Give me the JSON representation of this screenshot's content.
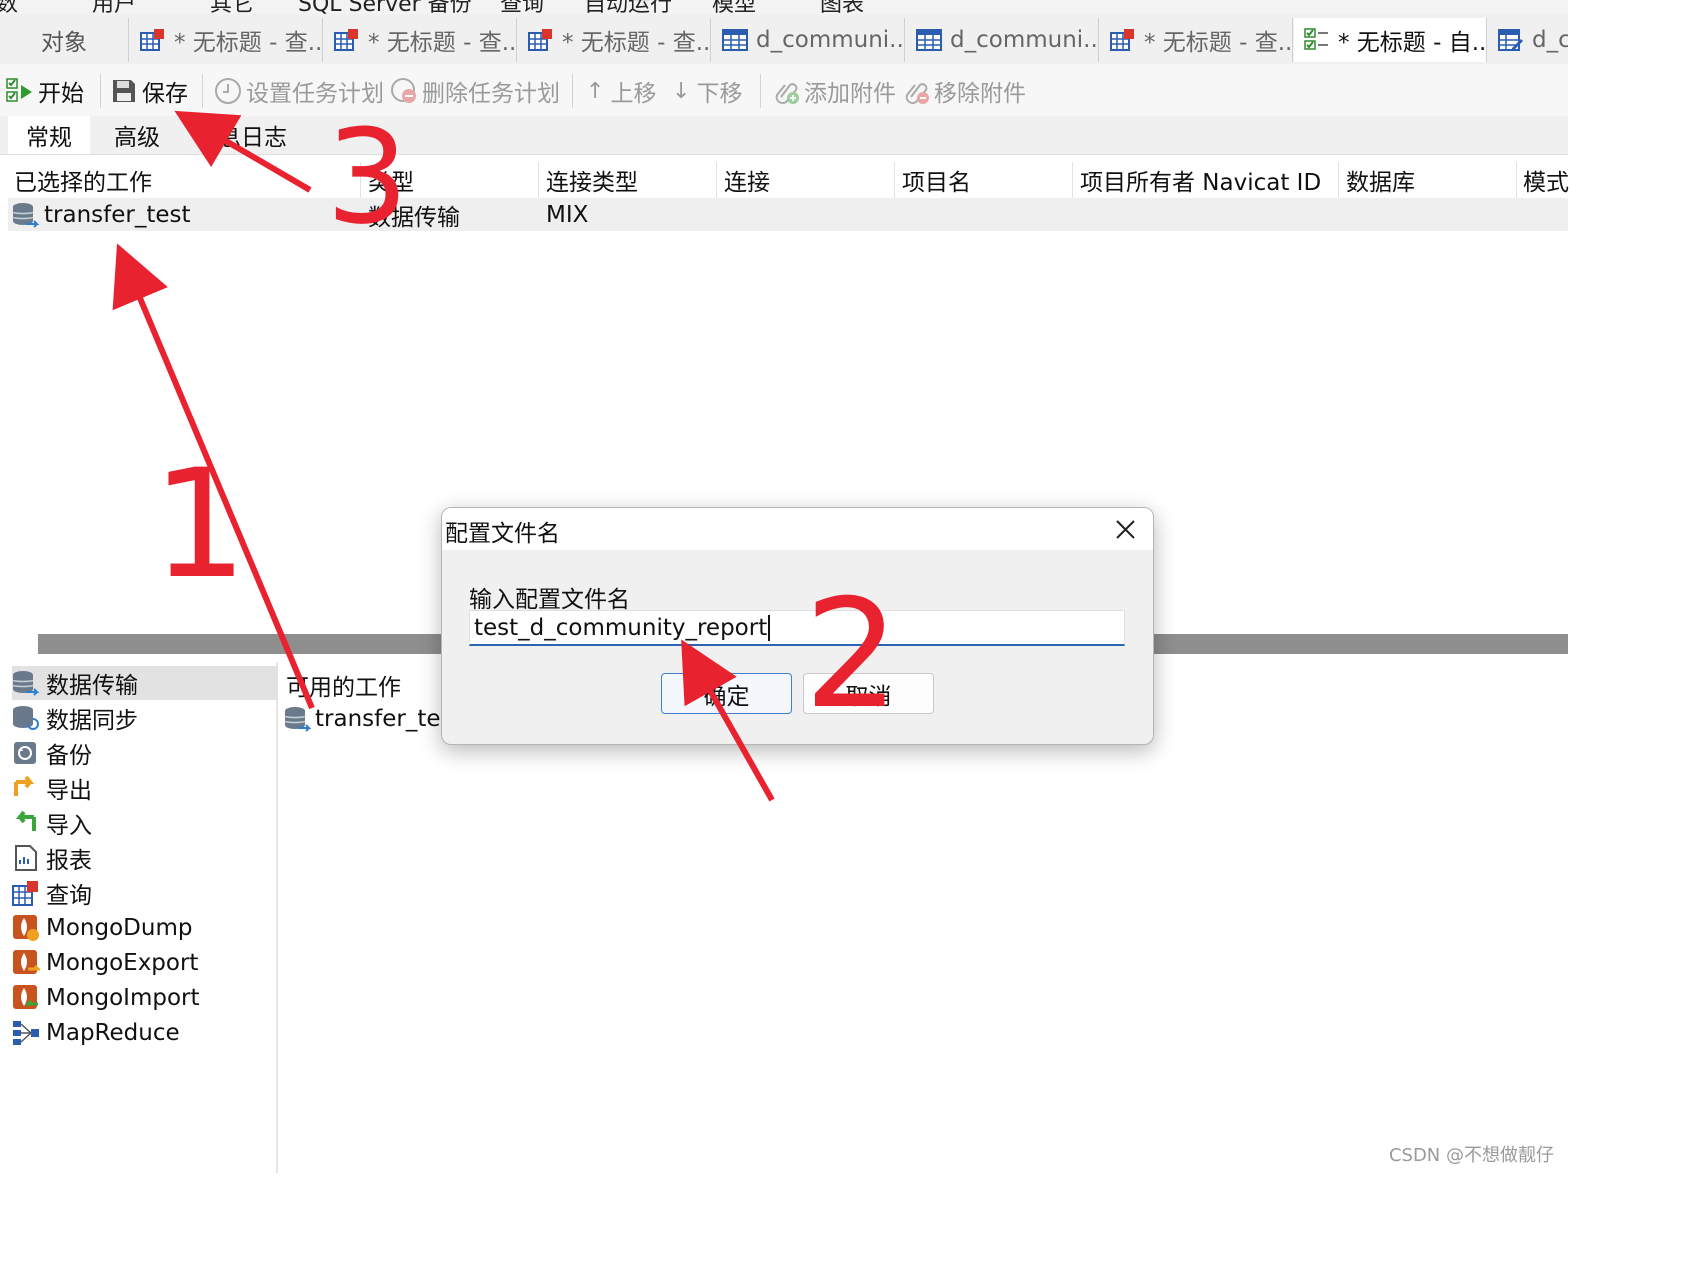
{
  "menu": {
    "items": [
      "数",
      "用户",
      "其它",
      "SQL Server 备份",
      "查询",
      "自动运行",
      "模型",
      "图表"
    ]
  },
  "tabs": {
    "objects": "对象",
    "items": [
      {
        "label": "* 无标题 - 查...",
        "icon": "query-grid-icon"
      },
      {
        "label": "* 无标题 - 查...",
        "icon": "query-grid-icon"
      },
      {
        "label": "* 无标题 - 查...",
        "icon": "query-grid-icon"
      },
      {
        "label": "d_communi...",
        "icon": "table-icon"
      },
      {
        "label": "d_communi...",
        "icon": "table-icon"
      },
      {
        "label": "* 无标题 - 查...",
        "icon": "query-grid-icon"
      },
      {
        "label": "* 无标题 - 自...",
        "icon": "automation-icon"
      },
      {
        "label": "d_c",
        "icon": "table-edit-icon"
      }
    ]
  },
  "toolbar": {
    "start": "开始",
    "save": "保存",
    "set_schedule": "设置任务计划",
    "delete_schedule": "删除任务计划",
    "move_up": "上移",
    "move_down": "下移",
    "add_attachment": "添加附件",
    "remove_attachment": "移除附件"
  },
  "subtabs": {
    "general": "常规",
    "advanced": "高级",
    "message_log": "信息日志"
  },
  "selected_jobs": {
    "headers": [
      "已选择的工作",
      "类型",
      "连接类型",
      "连接",
      "项目名",
      "项目所有者 Navicat ID",
      "数据库",
      "模式"
    ],
    "rows": [
      {
        "name": "transfer_test",
        "type": "数据传输",
        "conn_type": "MIX"
      }
    ]
  },
  "categories": {
    "items": [
      {
        "label": "数据传输",
        "icon": "data-transfer-icon"
      },
      {
        "label": "数据同步",
        "icon": "data-sync-icon"
      },
      {
        "label": "备份",
        "icon": "backup-icon"
      },
      {
        "label": "导出",
        "icon": "export-icon"
      },
      {
        "label": "导入",
        "icon": "import-icon"
      },
      {
        "label": "报表",
        "icon": "report-icon"
      },
      {
        "label": "查询",
        "icon": "query-icon"
      },
      {
        "label": "MongoDump",
        "icon": "mongo-dump-icon"
      },
      {
        "label": "MongoExport",
        "icon": "mongo-export-icon"
      },
      {
        "label": "MongoImport",
        "icon": "mongo-import-icon"
      },
      {
        "label": "MapReduce",
        "icon": "map-reduce-icon"
      }
    ]
  },
  "available_jobs": {
    "header": "可用的工作",
    "items": [
      "transfer_test"
    ]
  },
  "dialog": {
    "title": "配置文件名",
    "label": "输入配置文件名",
    "value": "test_d_community_report",
    "ok": "确定",
    "cancel": "取消"
  },
  "annotations": {
    "step1": "1",
    "step2": "2",
    "step3": "3",
    "color": "#e8232f"
  },
  "watermark": "CSDN @不想做靓仔"
}
